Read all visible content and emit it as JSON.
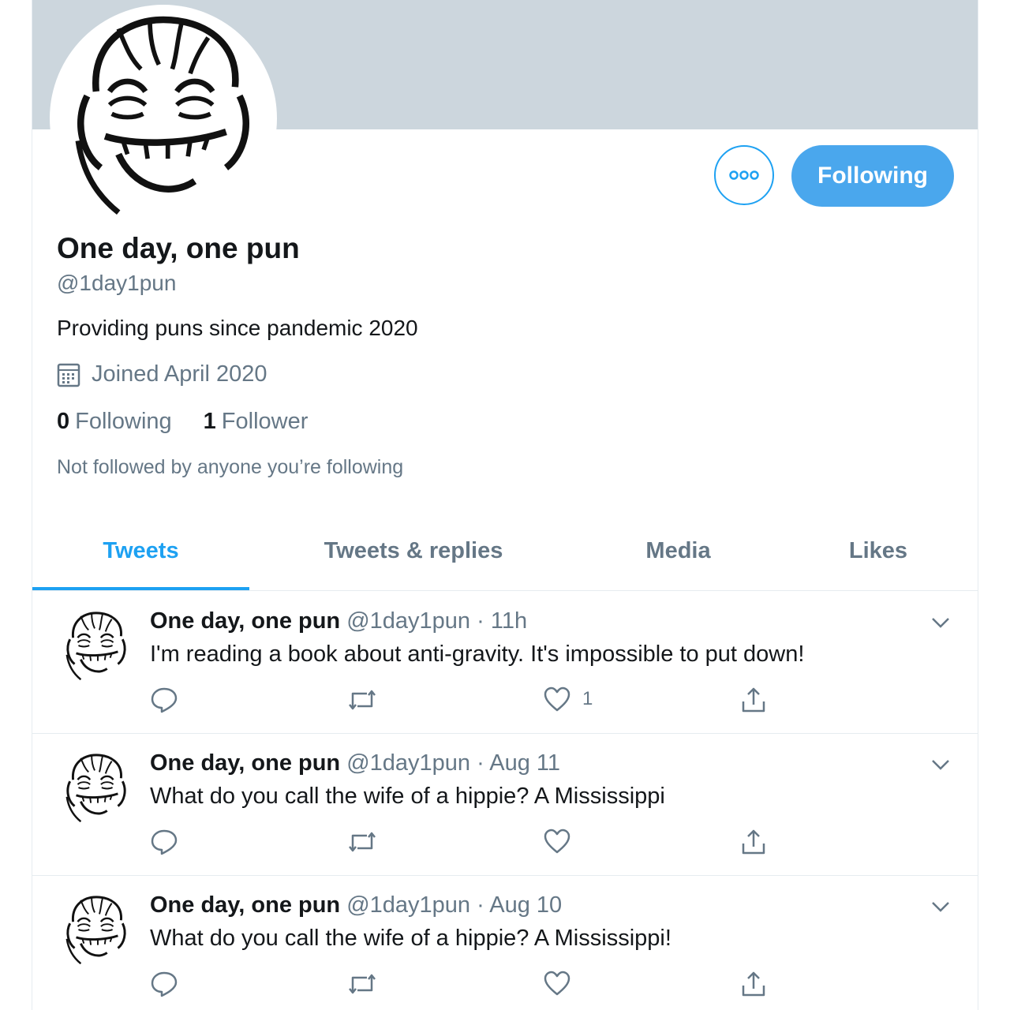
{
  "profile": {
    "display_name": "One day, one pun",
    "handle": "@1day1pun",
    "bio": "Providing puns since pandemic 2020",
    "joined": "Joined April 2020",
    "following_count": "0",
    "following_label": "Following",
    "followers_count": "1",
    "followers_label": "Follower",
    "not_followed_note": "Not followed by anyone you’re following",
    "follow_button_label": "Following",
    "banner_color": "#ccd6dd",
    "accent_color": "#1da1f2"
  },
  "tabs": [
    {
      "label": "Tweets",
      "active": true
    },
    {
      "label": "Tweets & replies",
      "active": false
    },
    {
      "label": "Media",
      "active": false
    },
    {
      "label": "Likes",
      "active": false
    }
  ],
  "tweets": [
    {
      "name": "One day, one pun",
      "handle": "@1day1pun",
      "time": "11h",
      "text": "I'm reading a book about anti-gravity. It's impossible to put down!",
      "likes": "1"
    },
    {
      "name": "One day, one pun",
      "handle": "@1day1pun",
      "time": "Aug 11",
      "text": "What do you call the wife of a hippie? A Mississippi",
      "likes": ""
    },
    {
      "name": "One day, one pun",
      "handle": "@1day1pun",
      "time": "Aug 10",
      "text": "What do you call the wife of a hippie? A Mississippi!",
      "likes": ""
    }
  ],
  "icons": {
    "more": "more-horizontal-icon",
    "calendar": "calendar-icon",
    "reply": "reply-icon",
    "retweet": "retweet-icon",
    "like": "heart-icon",
    "share": "share-icon",
    "caret": "chevron-down-icon"
  }
}
